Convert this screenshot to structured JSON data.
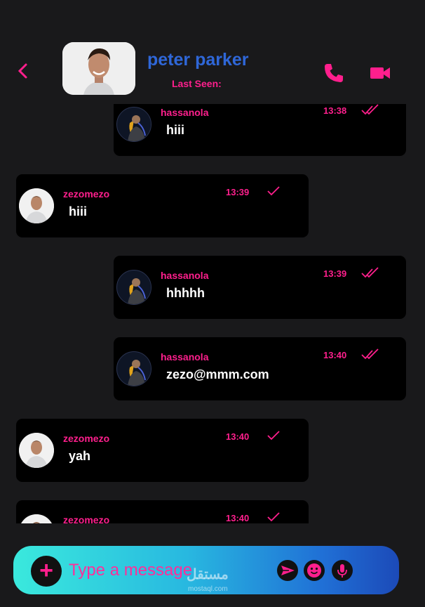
{
  "header": {
    "contact_name": "peter parker",
    "status": "Last Seen:",
    "back_icon": "chevron-left-icon",
    "call_icon": "phone-icon",
    "video_icon": "video-camera-icon"
  },
  "colors": {
    "accent": "#ff1f8d",
    "name": "#2f67d8",
    "background": "#19191b",
    "bubble": "#000000"
  },
  "messages": [
    {
      "direction": "out",
      "sender": "hassanola",
      "time": "13:38",
      "text": "hiii",
      "status_icon": "double-check-icon"
    },
    {
      "direction": "in",
      "sender": "zezomezo",
      "time": "13:39",
      "text": "hiii",
      "status_icon": "check-icon"
    },
    {
      "direction": "out",
      "sender": "hassanola",
      "time": "13:39",
      "text": "hhhhh",
      "status_icon": "double-check-icon"
    },
    {
      "direction": "out",
      "sender": "hassanola",
      "time": "13:40",
      "text": "zezo@mmm.com",
      "status_icon": "double-check-icon"
    },
    {
      "direction": "in",
      "sender": "zezomezo",
      "time": "13:40",
      "text": "yah",
      "status_icon": "check-icon"
    },
    {
      "direction": "in",
      "sender": "zezomezo",
      "time": "13:40",
      "text": "",
      "status_icon": "check-icon"
    }
  ],
  "composer": {
    "placeholder": "Type a message",
    "add_label": "+",
    "send_icon": "send-icon",
    "emoji_icon": "emoji-icon",
    "mic_icon": "microphone-icon"
  },
  "watermark": {
    "text": "مستقل",
    "sub": "mostaql.com"
  }
}
